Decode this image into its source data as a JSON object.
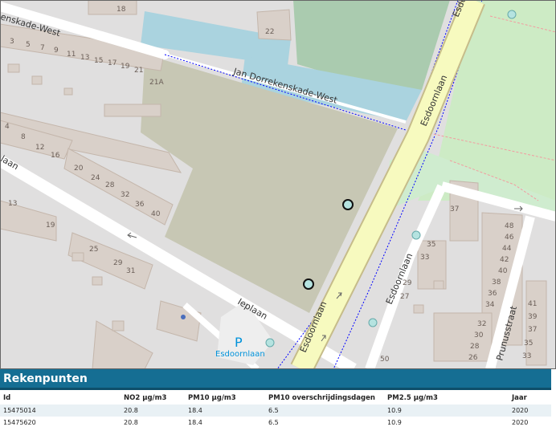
{
  "map": {
    "streets": [
      {
        "name": "enskade-West"
      },
      {
        "name": "Jan Dorrekenskade-West"
      },
      {
        "name": "Esdoornlaan"
      },
      {
        "name": "Esdoornlaan"
      },
      {
        "name": "Esdoornlaan"
      },
      {
        "name": "Esdoornlaan"
      },
      {
        "name": "laan"
      },
      {
        "name": "Ieplaan"
      },
      {
        "name": "Prunusstraat"
      },
      {
        "name": "Esdo"
      }
    ],
    "parking_label": "Esdoornlaan",
    "parking_symbol": "P",
    "house_numbers": [
      "18",
      "3",
      "5",
      "7",
      "9",
      "11",
      "13",
      "15",
      "17",
      "19",
      "21",
      "21A",
      "22",
      "4",
      "8",
      "12",
      "16",
      "20",
      "24",
      "28",
      "32",
      "36",
      "40",
      "13",
      "19",
      "25",
      "29",
      "31",
      "37",
      "35",
      "33",
      "29",
      "27",
      "48",
      "46",
      "44",
      "42",
      "40",
      "38",
      "36",
      "34",
      "32",
      "30",
      "28",
      "26",
      "50",
      "41",
      "39",
      "37",
      "35",
      "33"
    ],
    "colors": {
      "background": "#e0dfdf",
      "building": "#d9d0c9",
      "building_edge": "#c4b6ab",
      "water": "#aad3df",
      "cemetery": "#aacbaf",
      "park": "#c8facc",
      "major_road": "#f7fabf",
      "major_road_casing": "#c6bc8a",
      "brownfield": "#c7c7b4",
      "cycleway": "#0000ff",
      "rekenpunt_marker": "#b5e3e0"
    }
  },
  "panel": {
    "title": "Rekenpunten",
    "columns": [
      "Id",
      "NO2 µg/m3",
      "PM10 µg/m3",
      "PM10 overschrijdingsdagen",
      "PM2.5 µg/m3",
      "Jaar"
    ],
    "rows": [
      [
        "15475014",
        "20.8",
        "18.4",
        "6.5",
        "10.9",
        "2020"
      ],
      [
        "15475620",
        "20.8",
        "18.4",
        "6.5",
        "10.9",
        "2020"
      ]
    ],
    "colors": {
      "header": "#156e93",
      "alt_row": "#e9f1f5"
    }
  }
}
